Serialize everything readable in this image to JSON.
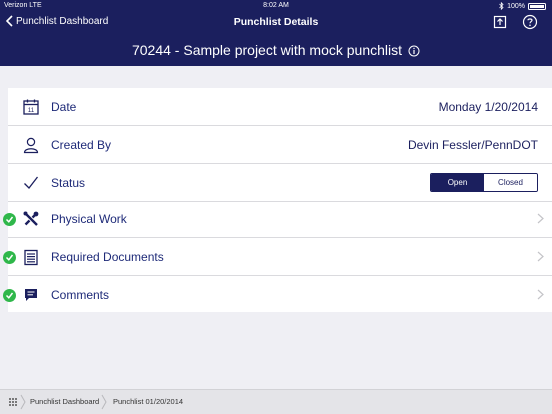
{
  "statusbar": {
    "carrier": "Verizon  LTE",
    "time": "8:02 AM",
    "battery": "100%"
  },
  "nav": {
    "back_label": "Punchlist Dashboard",
    "title": "Punchlist Details",
    "icons": [
      "upload-icon",
      "help-icon"
    ]
  },
  "project": {
    "title": "70244 - Sample project with mock punchlist"
  },
  "details": {
    "date_label": "Date",
    "date_value": "Monday  1/20/2014",
    "created_by_label": "Created By",
    "created_by_value": "Devin Fessler/PennDOT",
    "status_label": "Status",
    "status_options": [
      "Open",
      "Closed"
    ],
    "status_selected": "Open"
  },
  "sections": [
    {
      "label": "Physical Work",
      "icon": "tools-icon",
      "complete": true
    },
    {
      "label": "Required Documents",
      "icon": "document-icon",
      "complete": true
    },
    {
      "label": "Comments",
      "icon": "comment-icon",
      "complete": true
    }
  ],
  "breadcrumb": {
    "items": [
      "Punchlist Dashboard",
      "Punchlist 01/20/2014"
    ]
  },
  "colors": {
    "header": "#1b1f5e",
    "label": "#1e2a78",
    "check": "#2fb74a",
    "background": "#efeff4"
  }
}
